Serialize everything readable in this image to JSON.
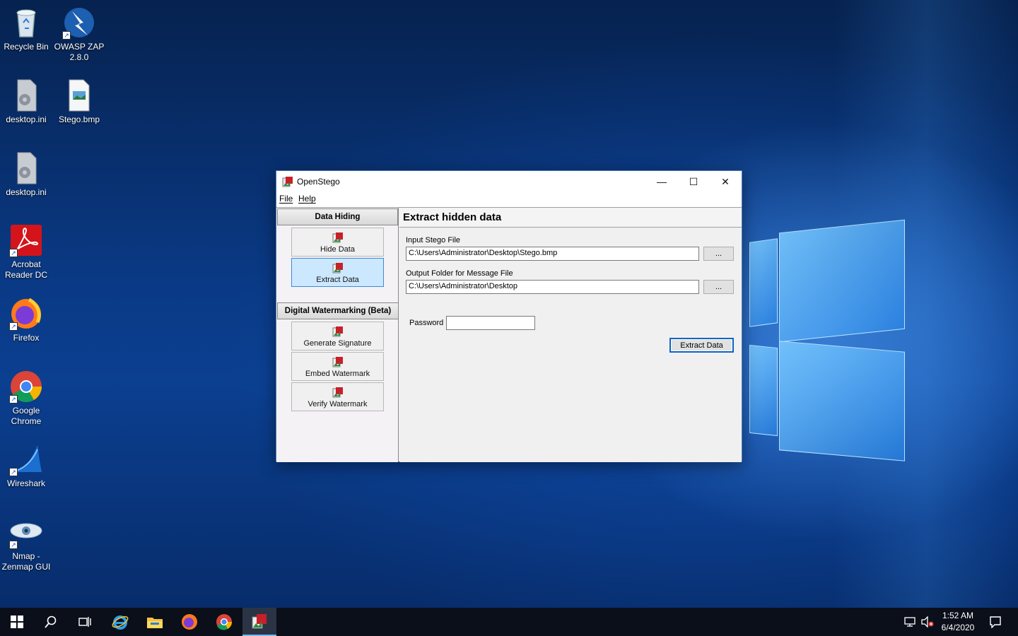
{
  "desktop": {
    "icons": [
      {
        "name": "recycle-bin",
        "label_lines": [
          "Recycle Bin"
        ]
      },
      {
        "name": "owasp-zap",
        "label_lines": [
          "OWASP ZAP",
          "2.8.0"
        ]
      },
      {
        "name": "desktop-ini-1",
        "label_lines": [
          "desktop.ini"
        ]
      },
      {
        "name": "stego-bmp",
        "label_lines": [
          "Stego.bmp"
        ]
      },
      {
        "name": "desktop-ini-2",
        "label_lines": [
          "desktop.ini"
        ]
      },
      {
        "name": "acrobat",
        "label_lines": [
          "Acrobat",
          "Reader DC"
        ]
      },
      {
        "name": "firefox",
        "label_lines": [
          "Firefox"
        ]
      },
      {
        "name": "chrome",
        "label_lines": [
          "Google",
          "Chrome"
        ]
      },
      {
        "name": "wireshark",
        "label_lines": [
          "Wireshark"
        ]
      },
      {
        "name": "nmap",
        "label_lines": [
          "Nmap -",
          "Zenmap GUI"
        ]
      }
    ]
  },
  "window": {
    "title": "OpenStego",
    "controls": {
      "minimize": "—",
      "maximize": "☐",
      "close": "✕"
    },
    "menu": {
      "file": "File",
      "help": "Help"
    },
    "left": {
      "data_hiding_header": "Data Hiding",
      "hide_data": "Hide Data",
      "extract_data": "Extract Data",
      "watermark_header": "Digital Watermarking (Beta)",
      "generate_signature": "Generate Signature",
      "embed_watermark": "Embed Watermark",
      "verify_watermark": "Verify Watermark"
    },
    "right": {
      "title": "Extract hidden data",
      "input_label": "Input Stego File",
      "input_value": "C:\\Users\\Administrator\\Desktop\\Stego.bmp",
      "browse_label": "...",
      "output_label": "Output Folder for Message File",
      "output_value": "C:\\Users\\Administrator\\Desktop",
      "password_label": "Password",
      "password_value": "",
      "extract_button": "Extract Data"
    }
  },
  "taskbar": {
    "clock_time": "1:52 AM",
    "clock_date": "6/4/2020",
    "apps": [
      "start",
      "search",
      "task-view",
      "internet-explorer",
      "file-explorer",
      "firefox",
      "chrome",
      "openstego"
    ]
  },
  "colors": {
    "accent": "#0a64c8",
    "selected_nav": "#cce8ff",
    "taskbar": "#0b0f1a"
  }
}
